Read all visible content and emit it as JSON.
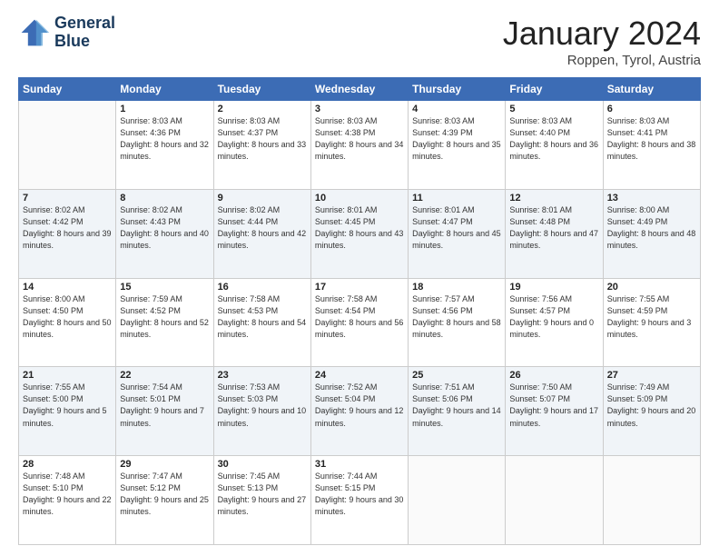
{
  "header": {
    "logo_line1": "General",
    "logo_line2": "Blue",
    "month_year": "January 2024",
    "location": "Roppen, Tyrol, Austria"
  },
  "weekdays": [
    "Sunday",
    "Monday",
    "Tuesday",
    "Wednesday",
    "Thursday",
    "Friday",
    "Saturday"
  ],
  "weeks": [
    [
      {
        "day": "",
        "sunrise": "",
        "sunset": "",
        "daylight": ""
      },
      {
        "day": "1",
        "sunrise": "Sunrise: 8:03 AM",
        "sunset": "Sunset: 4:36 PM",
        "daylight": "Daylight: 8 hours and 32 minutes."
      },
      {
        "day": "2",
        "sunrise": "Sunrise: 8:03 AM",
        "sunset": "Sunset: 4:37 PM",
        "daylight": "Daylight: 8 hours and 33 minutes."
      },
      {
        "day": "3",
        "sunrise": "Sunrise: 8:03 AM",
        "sunset": "Sunset: 4:38 PM",
        "daylight": "Daylight: 8 hours and 34 minutes."
      },
      {
        "day": "4",
        "sunrise": "Sunrise: 8:03 AM",
        "sunset": "Sunset: 4:39 PM",
        "daylight": "Daylight: 8 hours and 35 minutes."
      },
      {
        "day": "5",
        "sunrise": "Sunrise: 8:03 AM",
        "sunset": "Sunset: 4:40 PM",
        "daylight": "Daylight: 8 hours and 36 minutes."
      },
      {
        "day": "6",
        "sunrise": "Sunrise: 8:03 AM",
        "sunset": "Sunset: 4:41 PM",
        "daylight": "Daylight: 8 hours and 38 minutes."
      }
    ],
    [
      {
        "day": "7",
        "sunrise": "Sunrise: 8:02 AM",
        "sunset": "Sunset: 4:42 PM",
        "daylight": "Daylight: 8 hours and 39 minutes."
      },
      {
        "day": "8",
        "sunrise": "Sunrise: 8:02 AM",
        "sunset": "Sunset: 4:43 PM",
        "daylight": "Daylight: 8 hours and 40 minutes."
      },
      {
        "day": "9",
        "sunrise": "Sunrise: 8:02 AM",
        "sunset": "Sunset: 4:44 PM",
        "daylight": "Daylight: 8 hours and 42 minutes."
      },
      {
        "day": "10",
        "sunrise": "Sunrise: 8:01 AM",
        "sunset": "Sunset: 4:45 PM",
        "daylight": "Daylight: 8 hours and 43 minutes."
      },
      {
        "day": "11",
        "sunrise": "Sunrise: 8:01 AM",
        "sunset": "Sunset: 4:47 PM",
        "daylight": "Daylight: 8 hours and 45 minutes."
      },
      {
        "day": "12",
        "sunrise": "Sunrise: 8:01 AM",
        "sunset": "Sunset: 4:48 PM",
        "daylight": "Daylight: 8 hours and 47 minutes."
      },
      {
        "day": "13",
        "sunrise": "Sunrise: 8:00 AM",
        "sunset": "Sunset: 4:49 PM",
        "daylight": "Daylight: 8 hours and 48 minutes."
      }
    ],
    [
      {
        "day": "14",
        "sunrise": "Sunrise: 8:00 AM",
        "sunset": "Sunset: 4:50 PM",
        "daylight": "Daylight: 8 hours and 50 minutes."
      },
      {
        "day": "15",
        "sunrise": "Sunrise: 7:59 AM",
        "sunset": "Sunset: 4:52 PM",
        "daylight": "Daylight: 8 hours and 52 minutes."
      },
      {
        "day": "16",
        "sunrise": "Sunrise: 7:58 AM",
        "sunset": "Sunset: 4:53 PM",
        "daylight": "Daylight: 8 hours and 54 minutes."
      },
      {
        "day": "17",
        "sunrise": "Sunrise: 7:58 AM",
        "sunset": "Sunset: 4:54 PM",
        "daylight": "Daylight: 8 hours and 56 minutes."
      },
      {
        "day": "18",
        "sunrise": "Sunrise: 7:57 AM",
        "sunset": "Sunset: 4:56 PM",
        "daylight": "Daylight: 8 hours and 58 minutes."
      },
      {
        "day": "19",
        "sunrise": "Sunrise: 7:56 AM",
        "sunset": "Sunset: 4:57 PM",
        "daylight": "Daylight: 9 hours and 0 minutes."
      },
      {
        "day": "20",
        "sunrise": "Sunrise: 7:55 AM",
        "sunset": "Sunset: 4:59 PM",
        "daylight": "Daylight: 9 hours and 3 minutes."
      }
    ],
    [
      {
        "day": "21",
        "sunrise": "Sunrise: 7:55 AM",
        "sunset": "Sunset: 5:00 PM",
        "daylight": "Daylight: 9 hours and 5 minutes."
      },
      {
        "day": "22",
        "sunrise": "Sunrise: 7:54 AM",
        "sunset": "Sunset: 5:01 PM",
        "daylight": "Daylight: 9 hours and 7 minutes."
      },
      {
        "day": "23",
        "sunrise": "Sunrise: 7:53 AM",
        "sunset": "Sunset: 5:03 PM",
        "daylight": "Daylight: 9 hours and 10 minutes."
      },
      {
        "day": "24",
        "sunrise": "Sunrise: 7:52 AM",
        "sunset": "Sunset: 5:04 PM",
        "daylight": "Daylight: 9 hours and 12 minutes."
      },
      {
        "day": "25",
        "sunrise": "Sunrise: 7:51 AM",
        "sunset": "Sunset: 5:06 PM",
        "daylight": "Daylight: 9 hours and 14 minutes."
      },
      {
        "day": "26",
        "sunrise": "Sunrise: 7:50 AM",
        "sunset": "Sunset: 5:07 PM",
        "daylight": "Daylight: 9 hours and 17 minutes."
      },
      {
        "day": "27",
        "sunrise": "Sunrise: 7:49 AM",
        "sunset": "Sunset: 5:09 PM",
        "daylight": "Daylight: 9 hours and 20 minutes."
      }
    ],
    [
      {
        "day": "28",
        "sunrise": "Sunrise: 7:48 AM",
        "sunset": "Sunset: 5:10 PM",
        "daylight": "Daylight: 9 hours and 22 minutes."
      },
      {
        "day": "29",
        "sunrise": "Sunrise: 7:47 AM",
        "sunset": "Sunset: 5:12 PM",
        "daylight": "Daylight: 9 hours and 25 minutes."
      },
      {
        "day": "30",
        "sunrise": "Sunrise: 7:45 AM",
        "sunset": "Sunset: 5:13 PM",
        "daylight": "Daylight: 9 hours and 27 minutes."
      },
      {
        "day": "31",
        "sunrise": "Sunrise: 7:44 AM",
        "sunset": "Sunset: 5:15 PM",
        "daylight": "Daylight: 9 hours and 30 minutes."
      },
      {
        "day": "",
        "sunrise": "",
        "sunset": "",
        "daylight": ""
      },
      {
        "day": "",
        "sunrise": "",
        "sunset": "",
        "daylight": ""
      },
      {
        "day": "",
        "sunrise": "",
        "sunset": "",
        "daylight": ""
      }
    ]
  ]
}
